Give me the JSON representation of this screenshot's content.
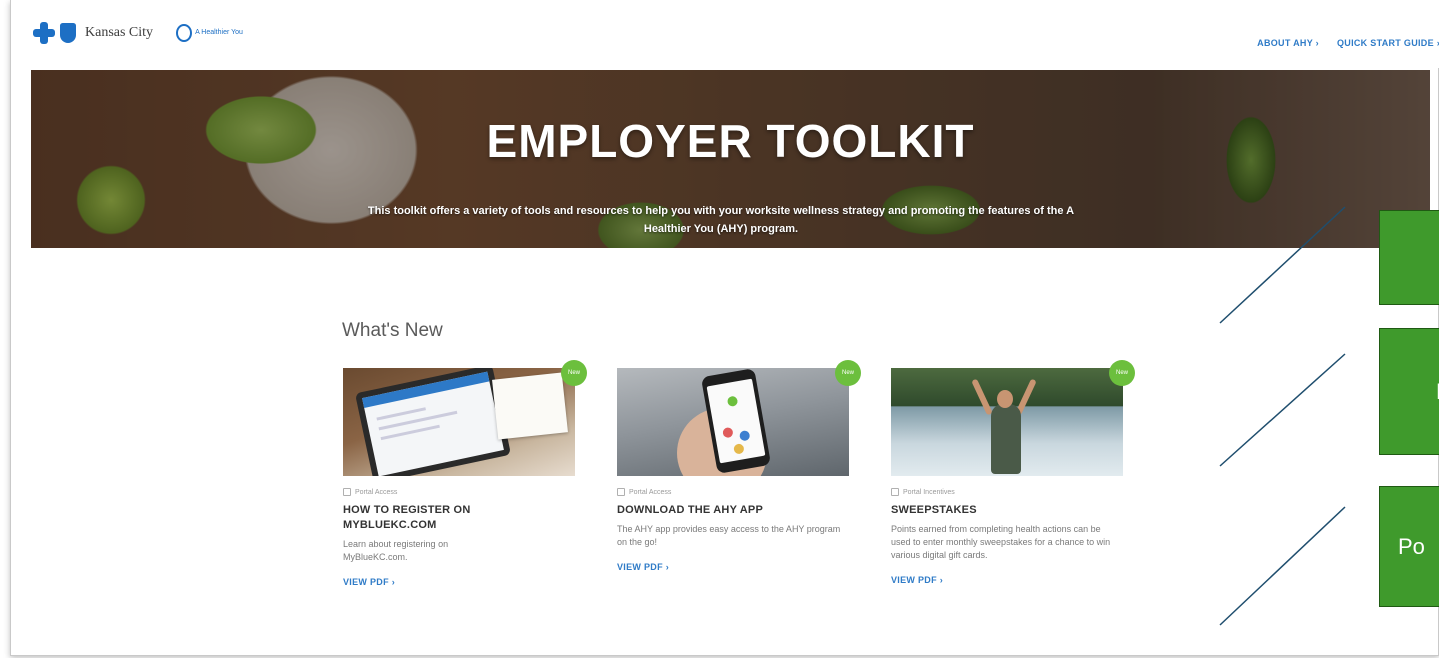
{
  "header": {
    "logo_text": "Kansas City",
    "partner_text": "A Healthier You",
    "nav": [
      {
        "label": "ABOUT AHY ›"
      },
      {
        "label": "QUICK START GUIDE ›"
      }
    ]
  },
  "hero": {
    "title": "EMPLOYER TOOLKIT",
    "subtitle": "This toolkit offers a variety of tools and resources to help you with your worksite wellness strategy and promoting the features of the A Healthier You (AHY) program."
  },
  "section": {
    "title": "What's New"
  },
  "cards": [
    {
      "badge": "New",
      "category": "Portal Access",
      "title": "HOW TO REGISTER ON MYBLUEKC.COM",
      "description": "Learn about registering on MyBlueKC.com.",
      "link": "VIEW PDF ›"
    },
    {
      "badge": "New",
      "category": "Portal Access",
      "title": "DOWNLOAD THE AHY APP",
      "description": "The AHY app provides easy access to the AHY program on the go!",
      "link": "VIEW PDF ›"
    },
    {
      "badge": "New",
      "category": "Portal Incentives",
      "title": "SWEEPSTAKES",
      "description": "Points earned from completing health actions can be used to enter monthly sweepstakes for a chance to win various digital gift cards.",
      "link": "VIEW PDF ›"
    }
  ],
  "overlays": [
    {
      "text": ""
    },
    {
      "text": "N"
    },
    {
      "text": "Po"
    }
  ],
  "colors": {
    "accent_blue": "#2f7bc7",
    "badge_green": "#6cbf3d",
    "overlay_green": "#3f9a2c",
    "line_color": "#1f4e6e"
  }
}
